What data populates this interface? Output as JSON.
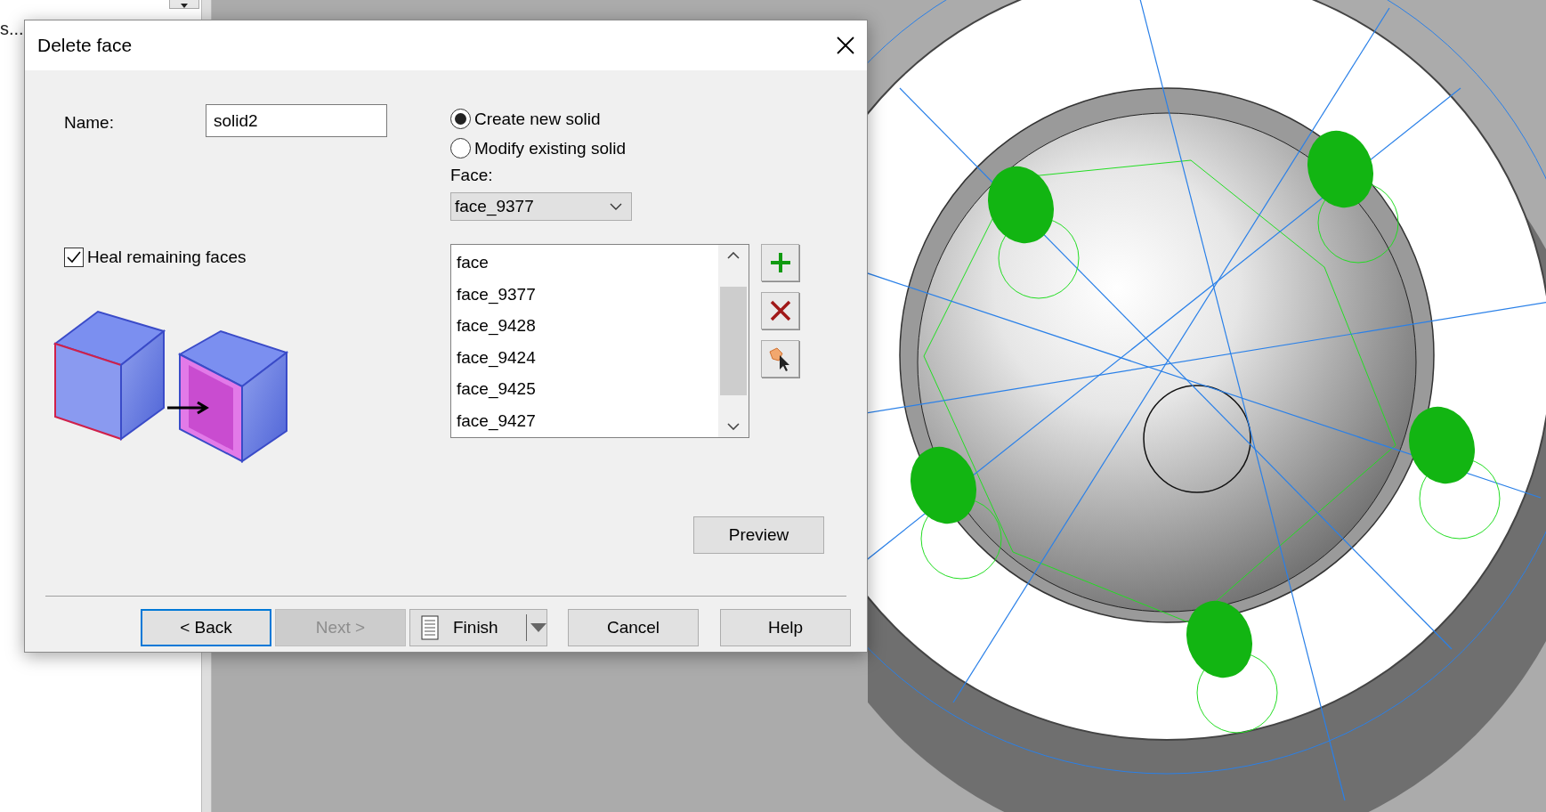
{
  "app": {
    "sidebar_text": "s..."
  },
  "dialog": {
    "title": "Delete face",
    "name_label": "Name:",
    "name_value": "solid2",
    "mode_options": [
      {
        "label": "Create new solid",
        "selected": true
      },
      {
        "label": "Modify existing solid",
        "selected": false
      }
    ],
    "face_label": "Face:",
    "face_combo": "face_9377",
    "heal": {
      "label": "Heal remaining faces",
      "checked": true
    },
    "face_list": [
      "face",
      "face_9377",
      "face_9428",
      "face_9424",
      "face_9425",
      "face_9427"
    ],
    "tool_buttons": [
      {
        "kind": "add"
      },
      {
        "kind": "remove"
      },
      {
        "kind": "pick"
      }
    ],
    "preview_button": "Preview",
    "buttons": [
      {
        "label": "< Back",
        "kind": "default",
        "disabled": false
      },
      {
        "label": "Next >",
        "kind": "normal",
        "disabled": true
      },
      {
        "label": "Finish",
        "kind": "split",
        "disabled": false
      },
      {
        "label": "Cancel",
        "kind": "normal",
        "disabled": false
      },
      {
        "label": "Help",
        "kind": "normal",
        "disabled": false
      }
    ]
  }
}
